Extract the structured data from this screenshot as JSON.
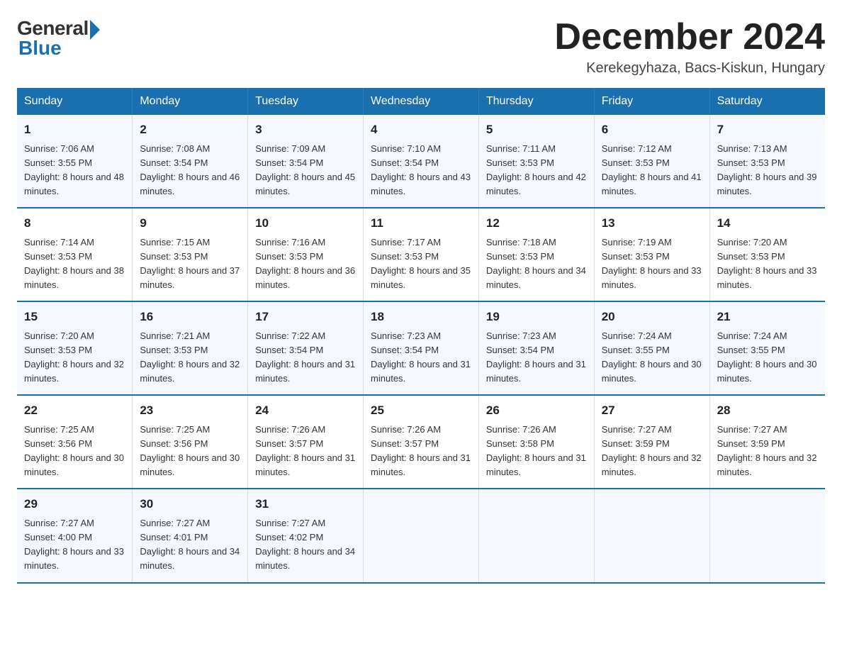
{
  "header": {
    "logo_general": "General",
    "logo_blue": "Blue",
    "month_title": "December 2024",
    "location": "Kerekegyhaza, Bacs-Kiskun, Hungary"
  },
  "weekdays": [
    "Sunday",
    "Monday",
    "Tuesday",
    "Wednesday",
    "Thursday",
    "Friday",
    "Saturday"
  ],
  "weeks": [
    [
      {
        "day": "1",
        "sunrise": "7:06 AM",
        "sunset": "3:55 PM",
        "daylight": "8 hours and 48 minutes."
      },
      {
        "day": "2",
        "sunrise": "7:08 AM",
        "sunset": "3:54 PM",
        "daylight": "8 hours and 46 minutes."
      },
      {
        "day": "3",
        "sunrise": "7:09 AM",
        "sunset": "3:54 PM",
        "daylight": "8 hours and 45 minutes."
      },
      {
        "day": "4",
        "sunrise": "7:10 AM",
        "sunset": "3:54 PM",
        "daylight": "8 hours and 43 minutes."
      },
      {
        "day": "5",
        "sunrise": "7:11 AM",
        "sunset": "3:53 PM",
        "daylight": "8 hours and 42 minutes."
      },
      {
        "day": "6",
        "sunrise": "7:12 AM",
        "sunset": "3:53 PM",
        "daylight": "8 hours and 41 minutes."
      },
      {
        "day": "7",
        "sunrise": "7:13 AM",
        "sunset": "3:53 PM",
        "daylight": "8 hours and 39 minutes."
      }
    ],
    [
      {
        "day": "8",
        "sunrise": "7:14 AM",
        "sunset": "3:53 PM",
        "daylight": "8 hours and 38 minutes."
      },
      {
        "day": "9",
        "sunrise": "7:15 AM",
        "sunset": "3:53 PM",
        "daylight": "8 hours and 37 minutes."
      },
      {
        "day": "10",
        "sunrise": "7:16 AM",
        "sunset": "3:53 PM",
        "daylight": "8 hours and 36 minutes."
      },
      {
        "day": "11",
        "sunrise": "7:17 AM",
        "sunset": "3:53 PM",
        "daylight": "8 hours and 35 minutes."
      },
      {
        "day": "12",
        "sunrise": "7:18 AM",
        "sunset": "3:53 PM",
        "daylight": "8 hours and 34 minutes."
      },
      {
        "day": "13",
        "sunrise": "7:19 AM",
        "sunset": "3:53 PM",
        "daylight": "8 hours and 33 minutes."
      },
      {
        "day": "14",
        "sunrise": "7:20 AM",
        "sunset": "3:53 PM",
        "daylight": "8 hours and 33 minutes."
      }
    ],
    [
      {
        "day": "15",
        "sunrise": "7:20 AM",
        "sunset": "3:53 PM",
        "daylight": "8 hours and 32 minutes."
      },
      {
        "day": "16",
        "sunrise": "7:21 AM",
        "sunset": "3:53 PM",
        "daylight": "8 hours and 32 minutes."
      },
      {
        "day": "17",
        "sunrise": "7:22 AM",
        "sunset": "3:54 PM",
        "daylight": "8 hours and 31 minutes."
      },
      {
        "day": "18",
        "sunrise": "7:23 AM",
        "sunset": "3:54 PM",
        "daylight": "8 hours and 31 minutes."
      },
      {
        "day": "19",
        "sunrise": "7:23 AM",
        "sunset": "3:54 PM",
        "daylight": "8 hours and 31 minutes."
      },
      {
        "day": "20",
        "sunrise": "7:24 AM",
        "sunset": "3:55 PM",
        "daylight": "8 hours and 30 minutes."
      },
      {
        "day": "21",
        "sunrise": "7:24 AM",
        "sunset": "3:55 PM",
        "daylight": "8 hours and 30 minutes."
      }
    ],
    [
      {
        "day": "22",
        "sunrise": "7:25 AM",
        "sunset": "3:56 PM",
        "daylight": "8 hours and 30 minutes."
      },
      {
        "day": "23",
        "sunrise": "7:25 AM",
        "sunset": "3:56 PM",
        "daylight": "8 hours and 30 minutes."
      },
      {
        "day": "24",
        "sunrise": "7:26 AM",
        "sunset": "3:57 PM",
        "daylight": "8 hours and 31 minutes."
      },
      {
        "day": "25",
        "sunrise": "7:26 AM",
        "sunset": "3:57 PM",
        "daylight": "8 hours and 31 minutes."
      },
      {
        "day": "26",
        "sunrise": "7:26 AM",
        "sunset": "3:58 PM",
        "daylight": "8 hours and 31 minutes."
      },
      {
        "day": "27",
        "sunrise": "7:27 AM",
        "sunset": "3:59 PM",
        "daylight": "8 hours and 32 minutes."
      },
      {
        "day": "28",
        "sunrise": "7:27 AM",
        "sunset": "3:59 PM",
        "daylight": "8 hours and 32 minutes."
      }
    ],
    [
      {
        "day": "29",
        "sunrise": "7:27 AM",
        "sunset": "4:00 PM",
        "daylight": "8 hours and 33 minutes."
      },
      {
        "day": "30",
        "sunrise": "7:27 AM",
        "sunset": "4:01 PM",
        "daylight": "8 hours and 34 minutes."
      },
      {
        "day": "31",
        "sunrise": "7:27 AM",
        "sunset": "4:02 PM",
        "daylight": "8 hours and 34 minutes."
      },
      null,
      null,
      null,
      null
    ]
  ]
}
